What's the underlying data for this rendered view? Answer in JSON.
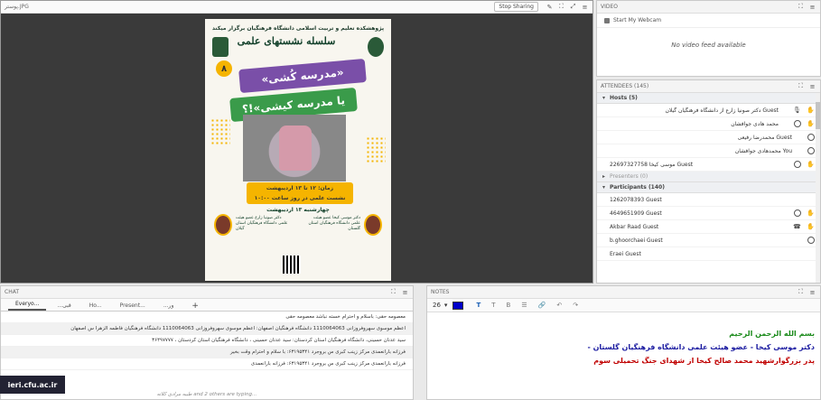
{
  "share": {
    "filename": "پوستر.JPG",
    "stop_label": "Stop Sharing",
    "slide": {
      "institute": "پژوهشکده تعلیم و تربیت اسلامی دانشگاه فرهنگیان برگزار میکند",
      "series_title": "سلسله نشستهای علمی",
      "number": "۸",
      "band1": "«مدرسه کُشی»",
      "band2": "یا مدرسه کیشی»!؟",
      "date_line1": "زمان: ۱۲ تا ۱۳ اردیبهشت",
      "date_line2": "نشست علمی در روز ساعت ۱۰:۰۰",
      "day": "چهارشنبه ۱۳ اردیبهشت",
      "speaker_right": "دکتر موسی کیخا عضو هیئت علمی دانشگاه فرهنگیان استان گلستان",
      "speaker_left": "دکتر صونیا زارع عضو هیئت علمی دانشگاه فرهنگیان استان گیلان"
    }
  },
  "video": {
    "title": "VIDEO",
    "webcam_label": "Start My Webcam",
    "no_feed": "No video feed available"
  },
  "attendees": {
    "title": "ATTENDEES  (145)",
    "hosts_label": "Hosts (5)",
    "hosts": [
      {
        "name": "دکتر صونیا زارع از دانشگاه فرهنگیان گیلان Guest",
        "icons": [
          "mic-icon",
          "hand-icon"
        ]
      },
      {
        "name": "محمد هادی جوافشان",
        "icons": [
          "globe-icon",
          "hand-icon"
        ]
      },
      {
        "name": "محمدرضا رفیعی Guest",
        "icons": [
          "globe-icon"
        ]
      },
      {
        "name": "محمدهادی جوافشان You",
        "icons": [
          "globe-icon"
        ]
      },
      {
        "name": "22697327758 موسی کیخا Guest",
        "icons": [
          "globe-icon",
          "hand-icon"
        ]
      }
    ],
    "presenters_label": "Presenters (0)",
    "participants_label": "Participants (140)",
    "participants": [
      {
        "name": "1262078393 Guest",
        "icons": []
      },
      {
        "name": "4649651909 Guest",
        "icons": [
          "globe-icon",
          "hand-icon"
        ]
      },
      {
        "name": "Akbar Raad Guest",
        "icons": [
          "phone-icon",
          "hand-icon"
        ]
      },
      {
        "name": "b.ghoorchaei Guest",
        "icons": [
          "globe-icon"
        ]
      },
      {
        "name": "Eraei Guest",
        "icons": []
      }
    ]
  },
  "chat": {
    "title": "CHAT",
    "tabs": [
      "Everyo...",
      "...قبی",
      "Ho...",
      "Present...",
      "...ور"
    ],
    "messages": [
      {
        "text": "معصومه حقی: باسلام و احترام خسته نباشد معصومه حقی",
        "alt": false
      },
      {
        "text": "اعظم موسوی سهروفروزانی 1110064063 دانشگاه فرهنگیان اصفهان: اعظم موسوی سهروفروزانی 1110064063 دانشگاه فرهنگیان فاطمه الزهرا س اصفهان",
        "alt": true
      },
      {
        "text": "سید عدنان حسینی، دانشگاه فرهنگیان استان کردستان: سید عدنان حسینی ، دانشگاه فرهنگیان استان کردستان ، ۳۶۴۹۷۷۷۷",
        "alt": false
      },
      {
        "text": "فرزانه بارانعمدی مرکز زینب کبری س بروجرد ۶۳۱۹۵۳۴۱: با سلام و احترام وقت بخیر",
        "alt": true
      },
      {
        "text": "فرزانه بارانعمدی مرکز زینب کبری س بروجرد ۶۳۱۹۵۳۴۱: فرزانه بارانعمدی",
        "alt": false
      }
    ],
    "typing": "طیبه مرادی کلاته and 2 others are typing...",
    "logo": "ieri.cfu.ac.ir"
  },
  "notes": {
    "title": "NOTES",
    "font_size": "26",
    "color": "#0000c8",
    "lines": [
      "بسم الله الرحمن الرحیم",
      "دکتر موسی کیخا - عضو هیئت علمی دانشگاه فرهنگیان گلستان -",
      "پدر بزرگوارشهید محمد صالح کیخا از شهدای جنگ تحمیلی سوم"
    ]
  }
}
